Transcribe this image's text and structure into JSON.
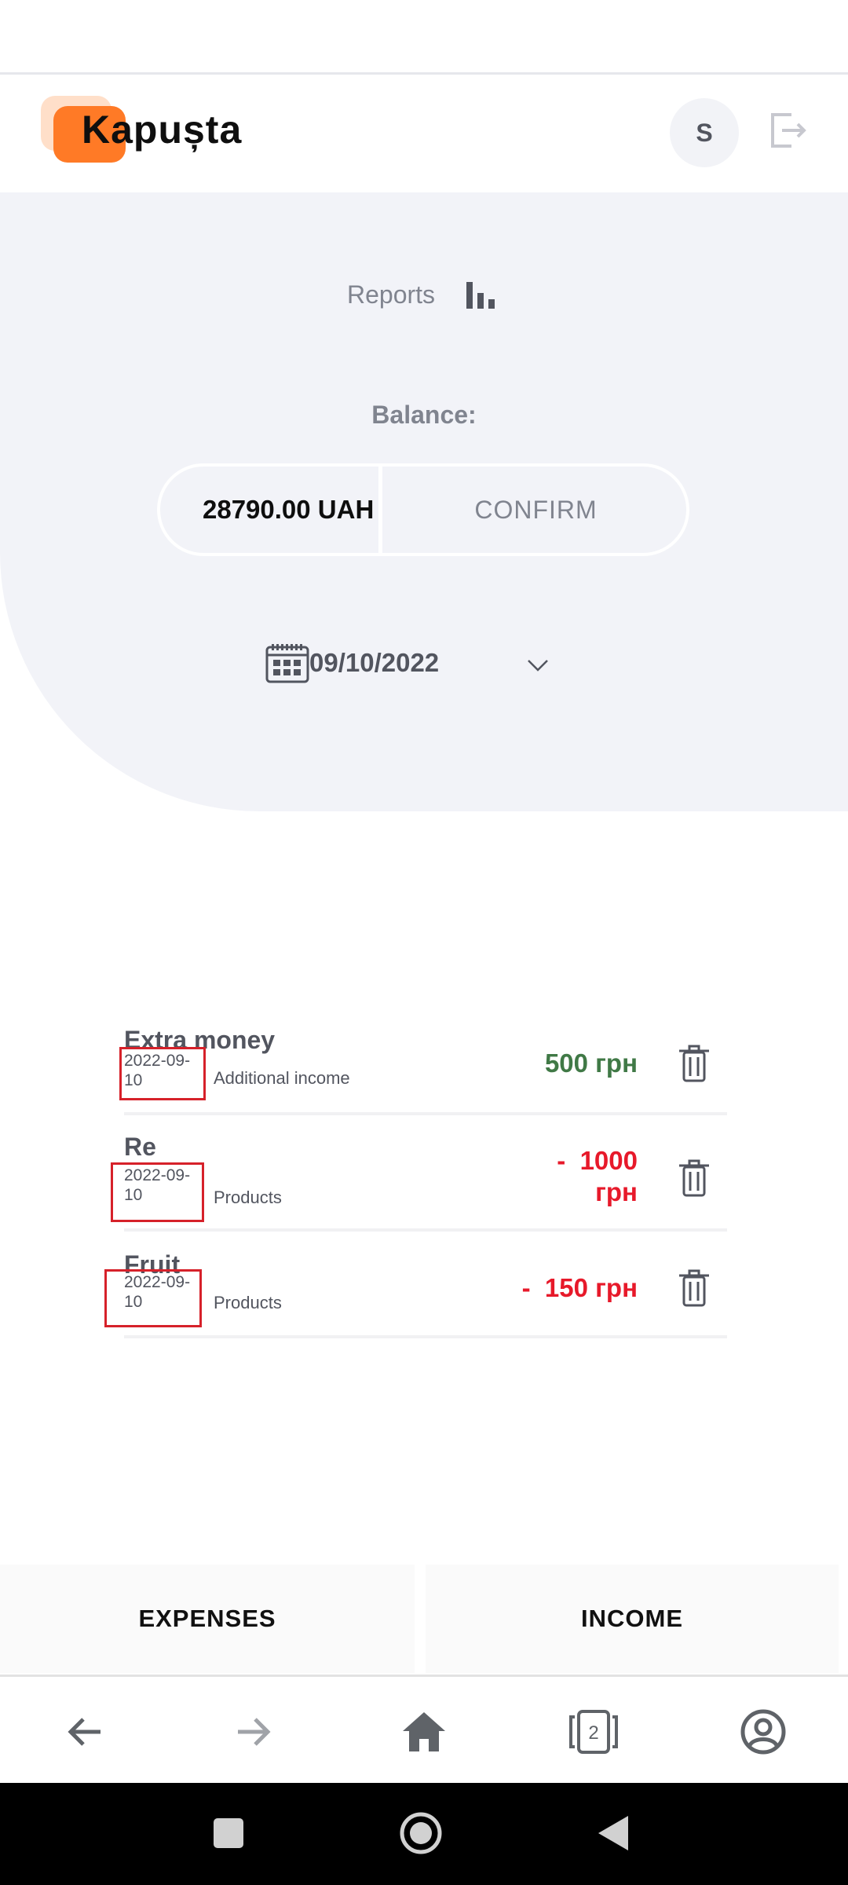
{
  "header": {
    "logo_text": "Kapușta",
    "avatar_letter": "S",
    "logo_color": "#ff7a26"
  },
  "reports": {
    "label": "Reports"
  },
  "balance": {
    "label": "Balance:",
    "value": "28790.00 UAH",
    "confirm_label": "CONFIRM"
  },
  "date_picker": {
    "value": "09/10/2022"
  },
  "transactions": [
    {
      "name": "Extra money",
      "date": "2022-09-10",
      "date_line1": "2022-09-",
      "date_line2": "10",
      "category": "Additional income",
      "amount": "500 грн",
      "type": "income",
      "color": "#407946"
    },
    {
      "name": "Re",
      "date": "2022-09-10",
      "date_line1": "2022-09-",
      "date_line2": "10",
      "category": "Products",
      "amount_line1": "-  1000",
      "amount_line2": "грн",
      "type": "expense",
      "color": "#e7192a"
    },
    {
      "name": "Fruit",
      "date": "2022-09-10",
      "date_line1": "2022-09-",
      "date_line2": "10",
      "category": "Products",
      "amount": "-  150 грн",
      "type": "expense",
      "color": "#e7192a"
    }
  ],
  "tabs": {
    "expenses": "EXPENSES",
    "income": "INCOME"
  },
  "browser_bar": {
    "tab_count": "2",
    "icons": [
      "back-icon",
      "forward-icon",
      "home-icon",
      "tabs-icon",
      "account-icon"
    ]
  },
  "system_nav": {
    "icons": [
      "recents-icon",
      "home-circle-icon",
      "back-triangle-icon"
    ]
  }
}
